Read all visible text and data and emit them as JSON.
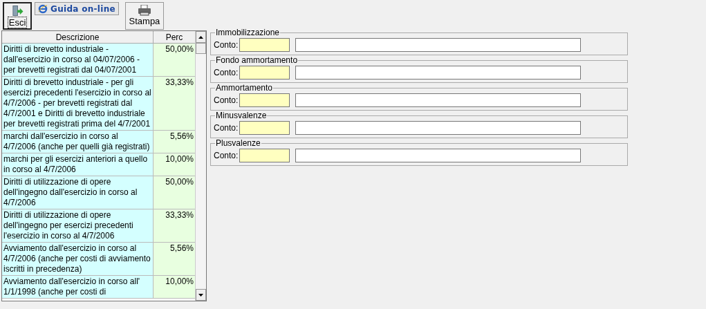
{
  "toolbar": [
    {
      "kind": "exit",
      "label": "Esci",
      "focused": true
    },
    {
      "kind": "help",
      "label": "Guida on-line",
      "focused": false
    },
    {
      "kind": "print",
      "label": "Stampa",
      "focused": false
    }
  ],
  "table": {
    "columns": [
      "Descrizione",
      "Perc"
    ],
    "rows": [
      {
        "description": "Diritti di brevetto industriale - dall'esercizio in corso al 04/07/2006 - per brevetti registrati dal 04/07/2001",
        "perc": "50,00%"
      },
      {
        "description": "Diritti di brevetto industriale  - per gli esercizi precedenti l'esercizio in corso al 4/7/2006 - per brevetti registrati dal 4/7/2001 e Diritti di brevetto industriale  per brevetti registrati prima del 4/7/2001",
        "perc": "33,33%"
      },
      {
        "description": "marchi dall'esercizio in corso al 4/7/2006 (anche per quelli già registrati)",
        "perc": "5,56%"
      },
      {
        "description": "marchi per gli esercizi anteriori a quello in corso al 4/7/2006",
        "perc": "10,00%"
      },
      {
        "description": "Diritti di utilizzazione di opere dell'ingegno dall'esercizio in corso al 4/7/2006",
        "perc": "50,00%"
      },
      {
        "description": "Diritti di utilizzazione di opere dell'ingegno per esercizi precedenti l'esercizio in corso al 4/7/2006",
        "perc": "33,33%"
      },
      {
        "description": "Avviamento dall'esercizio in corso al 4/7/2006  (anche per costi di avviamento iscritti in precedenza)",
        "perc": "5,56%"
      },
      {
        "description": "Avviamento dall'esercizio in corso all' 1/1/1998  (anche per costi di",
        "perc": "10,00%"
      }
    ]
  },
  "groups": [
    {
      "title": "Immobilizzazione",
      "label": "Conto:"
    },
    {
      "title": "Fondo ammortamento",
      "label": "Conto:"
    },
    {
      "title": "Ammortamento",
      "label": "Conto:"
    },
    {
      "title": "Minusvalenze",
      "label": "Conto:"
    },
    {
      "title": "Plusvalenze",
      "label": "Conto:"
    }
  ]
}
